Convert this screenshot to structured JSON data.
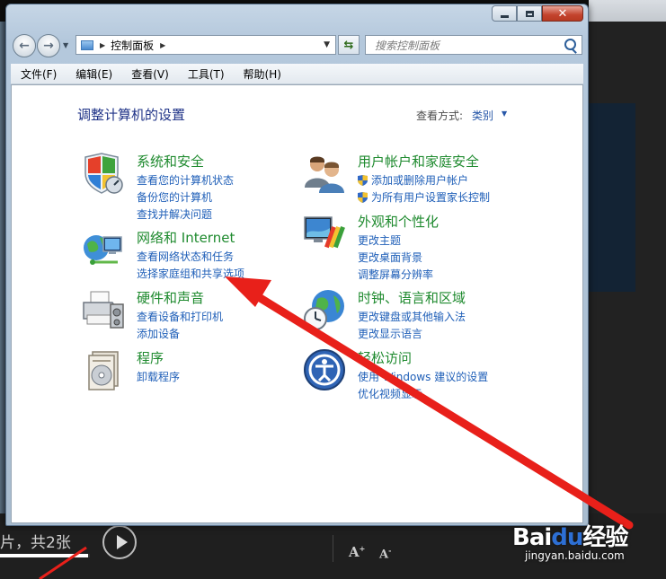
{
  "background": {
    "caption": "片，共2张",
    "progress_fraction": 0.98
  },
  "watermark": {
    "logo_part1": "Bai",
    "logo_part2": "du",
    "logo_part3": "经验",
    "url": "jingyan.baidu.com"
  },
  "window": {
    "address": {
      "crumb": "控制面板"
    },
    "search": {
      "placeholder": "搜索控制面板"
    },
    "menu": [
      "文件(F)",
      "编辑(E)",
      "查看(V)",
      "工具(T)",
      "帮助(H)"
    ],
    "content": {
      "title": "调整计算机的设置",
      "view_label": "查看方式:",
      "view_value": "类别",
      "categories": [
        {
          "title": "系统和安全",
          "links": [
            "查看您的计算机状态",
            "备份您的计算机",
            "查找并解决问题"
          ]
        },
        {
          "title": "网络和 Internet",
          "links": [
            "查看网络状态和任务",
            "选择家庭组和共享选项"
          ]
        },
        {
          "title": "硬件和声音",
          "links": [
            "查看设备和打印机",
            "添加设备"
          ]
        },
        {
          "title": "程序",
          "links": [
            "卸载程序"
          ]
        },
        {
          "title": "用户帐户和家庭安全",
          "links": [
            "添加或删除用户帐户",
            "为所有用户设置家长控制"
          ]
        },
        {
          "title": "外观和个性化",
          "links": [
            "更改主题",
            "更改桌面背景",
            "调整屏幕分辨率"
          ]
        },
        {
          "title": "时钟、语言和区域",
          "links": [
            "更改键盘或其他输入法",
            "更改显示语言"
          ]
        },
        {
          "title": "轻松访问",
          "links": [
            "使用 Windows 建议的设置",
            "优化视频显示"
          ]
        }
      ]
    }
  },
  "colors": {
    "category_title": "#1e8a2e",
    "link": "#1f5fb8",
    "page_title": "#1e3287",
    "annotation_arrow": "#e8201a"
  }
}
